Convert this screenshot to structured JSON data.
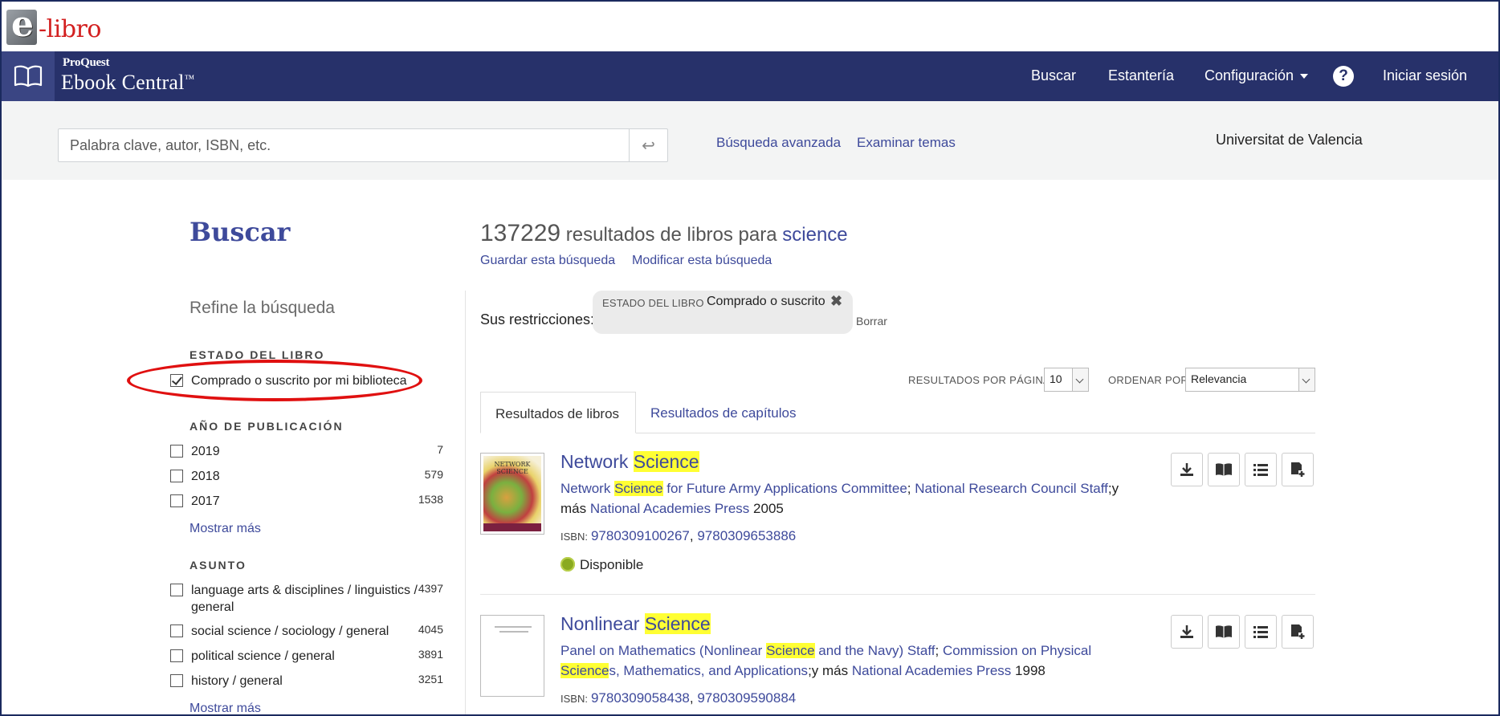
{
  "brand": {
    "logo_e": "e",
    "logo_libro": "-libro"
  },
  "nav": {
    "proquest": "ProQuest",
    "ebook_central": "Ebook Central",
    "tm": "™",
    "buscar": "Buscar",
    "estanteria": "Estantería",
    "configuracion": "Configuración",
    "help": "?",
    "iniciar": "Iniciar sesión"
  },
  "search": {
    "placeholder": "Palabra clave, autor, ISBN, etc.",
    "go_icon": "↩",
    "advanced": "Búsqueda avanzada",
    "browse": "Examinar temas",
    "institution": "Universitat de Valencia"
  },
  "left": {
    "heading": "Buscar",
    "refine": "Refine la búsqueda",
    "estado": {
      "heading": "ESTADO DEL LIBRO",
      "item": "Comprado o suscrito por mi biblioteca",
      "checked": true
    },
    "anio": {
      "heading": "AÑO DE PUBLICACIÓN",
      "items": [
        {
          "label": "2019",
          "count": "7"
        },
        {
          "label": "2018",
          "count": "579"
        },
        {
          "label": "2017",
          "count": "1538"
        }
      ],
      "more": "Mostrar más"
    },
    "asunto": {
      "heading": "ASUNTO",
      "items": [
        {
          "label": "language arts & disciplines / linguistics / general",
          "count": "4397"
        },
        {
          "label": "social science / sociology / general",
          "count": "4045"
        },
        {
          "label": "political science / general",
          "count": "3891"
        },
        {
          "label": "history / general",
          "count": "3251"
        }
      ],
      "more": "Mostrar más"
    }
  },
  "results": {
    "count": "137229",
    "text": " resultados de libros para ",
    "keyword": "science",
    "save": "Guardar esta búsqueda",
    "modify": "Modificar esta búsqueda",
    "restrictions_label": "Sus restricciones:",
    "chip": {
      "key": "ESTADO DEL LIBRO",
      "value": "Comprado o suscrito",
      "close": "✖"
    },
    "clear": "Borrar",
    "per_page_label": "RESULTADOS POR PÁGINA",
    "per_page": "10",
    "sort_label": "ORDENAR POR",
    "sort": "Relevancia",
    "tabs": [
      "Resultados de libros",
      "Resultados de capítulos"
    ],
    "items": [
      {
        "title_a": "Network ",
        "title_hl": "Science",
        "author_a": "Network ",
        "author_hl": "Science",
        "author_b": " for Future Army Applications Committee",
        "sep1": "; ",
        "author2": "National Research Council Staff",
        "more": ";y más",
        "publisher": "National Academies Press",
        "year": "2005",
        "isbn_label": "ISBN:",
        "isbn1": "9780309100267",
        "isbn2": "9780309653886",
        "status": "Disponible",
        "cover_text": "NETWORK SCIENCE"
      },
      {
        "title_a": "Nonlinear ",
        "title_hl": "Science",
        "author_a": "Panel on Mathematics (Nonlinear ",
        "author_hl": "Science",
        "author_b": " and the Navy) Staff",
        "sep1": "; ",
        "author2_a": "Commission on Physical ",
        "author2_hl": "Science",
        "author2_b": "s, Mathematics, and Applications",
        "more": ";y más",
        "publisher": "National Academies Press",
        "year": "1998",
        "isbn_label": "ISBN:",
        "isbn1": "9780309058438",
        "isbn2": "9780309590884"
      }
    ],
    "action_icons": [
      "download-icon",
      "read-online-icon",
      "list-icon",
      "add-to-shelf-icon"
    ]
  },
  "colors": {
    "navy": "#27316a",
    "link": "#3e4a9b",
    "highlight": "#ffff33",
    "annotation": "#e01010"
  }
}
